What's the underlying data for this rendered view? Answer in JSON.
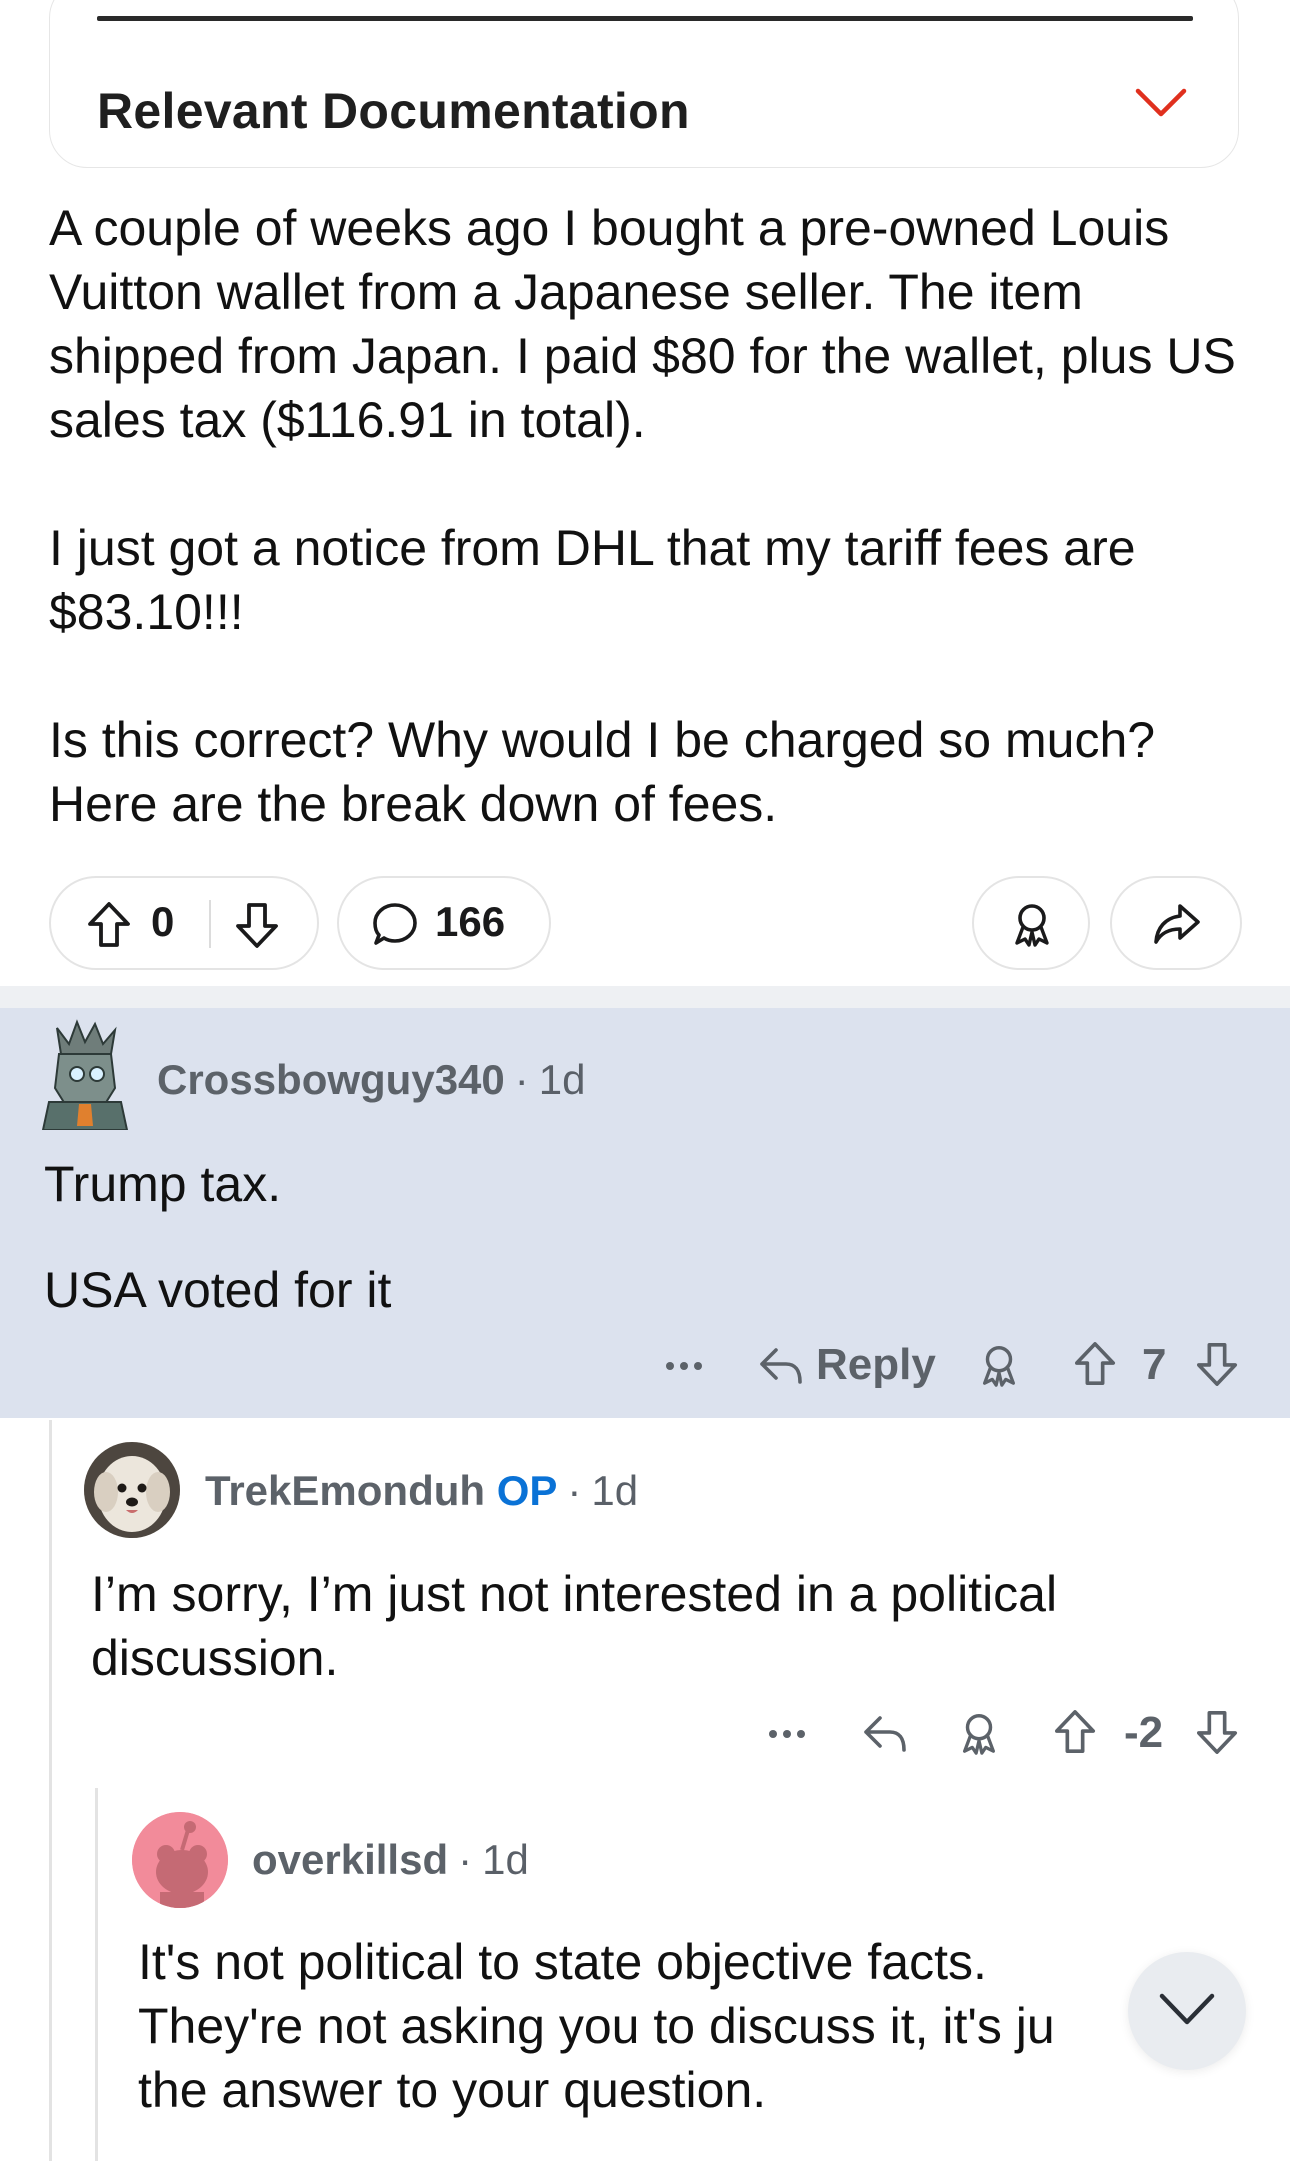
{
  "doc_card": {
    "title": "Relevant Documentation"
  },
  "post": {
    "paragraphs": [
      "A couple of weeks ago I bought a pre-owned Louis Vuitton wallet from a Japanese seller. The item shipped from Japan. I paid $80 for the wallet, plus US sales tax ($116.91 in total).",
      "I just got a notice from DHL that my tariff fees are $83.10!!!",
      "Is this correct? Why would I be charged so much? Here are the break down of fees."
    ],
    "vote_count": "0",
    "comment_count": "166"
  },
  "comments": [
    {
      "username": "Crossbowguy340",
      "age": "1d",
      "paragraphs": [
        "Trump tax.",
        "USA voted for it"
      ],
      "reply_label": "Reply",
      "score": "7"
    },
    {
      "username": "TrekEmonduh",
      "op_badge": "OP",
      "age": "1d",
      "paragraphs": [
        "I’m sorry, I’m just not interested in a political discussion."
      ],
      "score": "-2"
    },
    {
      "username": "overkillsd",
      "age": "1d",
      "paragraphs": [
        "It's not political to state objective facts. They're not asking you to discuss it, it's ju the answer to your question."
      ]
    }
  ],
  "icons": {
    "doc_toggle": "chevron-down-icon",
    "upvote": "arrow-up-icon",
    "downvote": "arrow-down-icon",
    "comments": "speech-bubble-icon",
    "award": "award-icon",
    "share": "share-arrow-icon",
    "more": "more-dots-icon",
    "reply": "reply-arrow-icon",
    "scroll": "chevron-down-icon"
  },
  "colors": {
    "accent": "#e0301e",
    "op": "#0a72d6",
    "highlight": "#dce2ee"
  }
}
